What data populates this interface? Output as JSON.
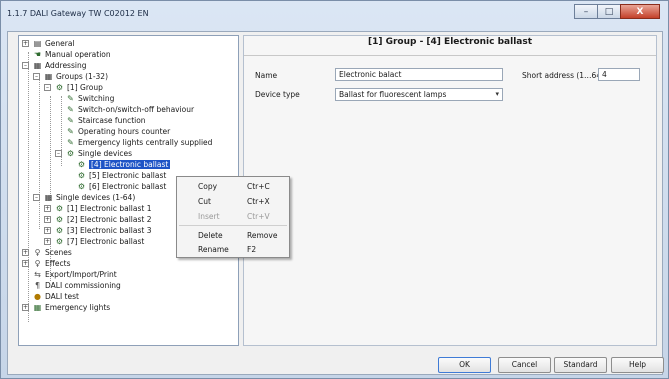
{
  "window": {
    "title": "1.1.7 DALI Gateway TW C02012 EN"
  },
  "window_controls": {
    "minimize": "–",
    "maximize": "□",
    "close": "X"
  },
  "tree": {
    "items": [
      {
        "label": "General",
        "icon": "general-icon"
      },
      {
        "label": "Manual operation",
        "icon": "manual-operation-icon"
      },
      {
        "label": "Addressing",
        "icon": "addressing-icon"
      },
      {
        "label": "Groups (1-32)",
        "icon": "groups-icon"
      },
      {
        "label": "[1] Group",
        "icon": "group-icon"
      },
      {
        "label": "Switching",
        "icon": "parameter-icon"
      },
      {
        "label": "Switch-on/switch-off behaviour",
        "icon": "parameter-icon"
      },
      {
        "label": "Staircase function",
        "icon": "parameter-icon"
      },
      {
        "label": "Operating hours counter",
        "icon": "parameter-icon"
      },
      {
        "label": "Emergency lights centrally supplied",
        "icon": "parameter-icon"
      },
      {
        "label": "Single devices",
        "icon": "single-devices-icon"
      },
      {
        "label": "[4] Electronic ballast",
        "icon": "ballast-icon"
      },
      {
        "label": "[5] Electronic ballast",
        "icon": "ballast-icon"
      },
      {
        "label": "[6] Electronic ballast",
        "icon": "ballast-icon"
      },
      {
        "label": "Single devices (1-64)",
        "icon": "groups-icon"
      },
      {
        "label": "[1] Electronic ballast 1",
        "icon": "ballast-icon"
      },
      {
        "label": "[2] Electronic ballast 2",
        "icon": "ballast-icon"
      },
      {
        "label": "[3] Electronic ballast 3",
        "icon": "ballast-icon"
      },
      {
        "label": "[7] Electronic ballast",
        "icon": "ballast-icon"
      },
      {
        "label": "Scenes",
        "icon": "scenes-icon"
      },
      {
        "label": "Effects",
        "icon": "effects-icon"
      },
      {
        "label": "Export/Import/Print",
        "icon": "export-icon"
      },
      {
        "label": "DALI commissioning",
        "icon": "commissioning-icon"
      },
      {
        "label": "DALI test",
        "icon": "test-icon"
      },
      {
        "label": "Emergency lights",
        "icon": "emergency-icon"
      }
    ]
  },
  "panel": {
    "title": "[1] Group - [4] Electronic ballast",
    "name_label": "Name",
    "name_value": "Electronic balact",
    "short_address_label": "Short address (1…64)",
    "short_address_value": "4",
    "device_type_label": "Device type",
    "device_type_value": "Ballast for fluorescent lamps"
  },
  "context_menu": {
    "items": [
      {
        "label": "Copy",
        "shortcut": "Ctr+C",
        "enabled": true
      },
      {
        "label": "Cut",
        "shortcut": "Ctr+X",
        "enabled": true
      },
      {
        "label": "Insert",
        "shortcut": "Ctr+V",
        "enabled": false
      },
      {
        "label": "Delete",
        "shortcut": "Remove",
        "enabled": true
      },
      {
        "label": "Rename",
        "shortcut": "F2",
        "enabled": true
      }
    ]
  },
  "footer": {
    "ok": "OK",
    "cancel": "Cancel",
    "standard": "Standard",
    "help": "Help"
  }
}
